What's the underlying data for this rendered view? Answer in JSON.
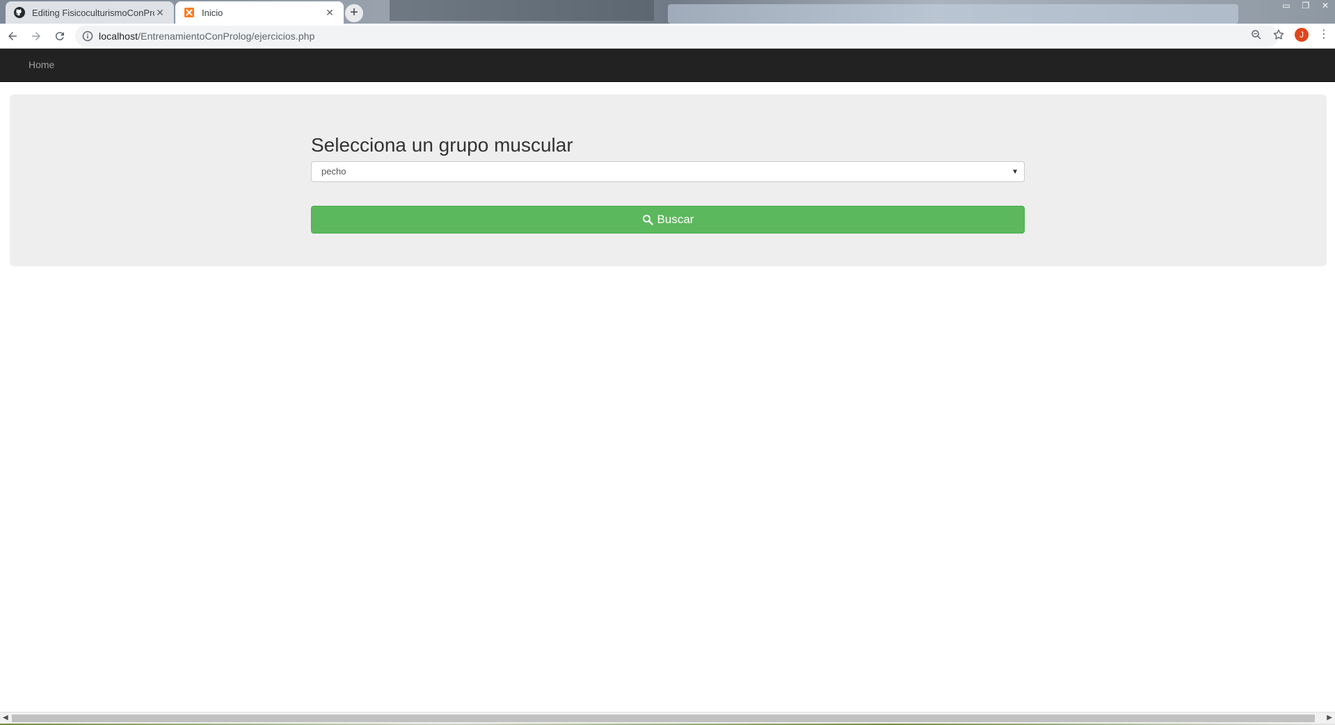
{
  "browser": {
    "tabs": [
      {
        "title": "Editing FisicoculturismoConProlog",
        "active": false,
        "favicon": "github-icon"
      },
      {
        "title": "Inicio",
        "active": true,
        "favicon": "xampp-icon"
      }
    ],
    "url_host": "localhost",
    "url_path": "/EntrenamientoConProlog/ejercicios.php",
    "profile_initial": "J"
  },
  "navbar": {
    "home_label": "Home"
  },
  "main": {
    "heading": "Selecciona un grupo muscular",
    "select_value": "pecho",
    "search_button_label": "Buscar",
    "accent_color": "#5cb85c"
  }
}
